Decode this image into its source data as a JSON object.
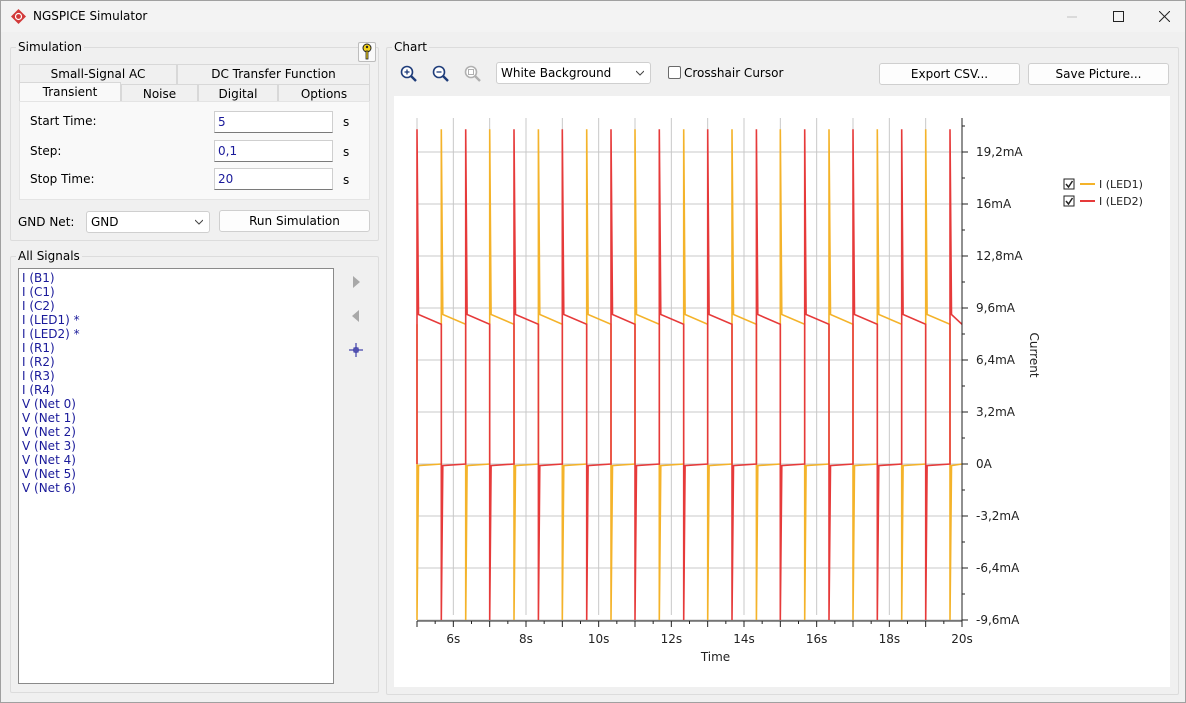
{
  "window": {
    "title": "NGSPICE Simulator"
  },
  "simulation": {
    "group_title": "Simulation",
    "tabs_row1": [
      "Small-Signal AC",
      "DC Transfer Function"
    ],
    "tabs_row2": [
      "Transient",
      "Noise",
      "Digital",
      "Options"
    ],
    "active_tab": "Transient",
    "fields": {
      "start_time": {
        "label": "Start Time:",
        "value": "5",
        "unit": "s"
      },
      "step": {
        "label": "Step:",
        "value": "0,1",
        "unit": "s"
      },
      "stop_time": {
        "label": "Stop Time:",
        "value": "20",
        "unit": "s"
      }
    },
    "gnd_label": "GND Net:",
    "gnd_value": "GND",
    "run_button": "Run Simulation"
  },
  "signals": {
    "group_title": "All Signals",
    "items": [
      "I (B1)",
      "I (C1)",
      "I (C2)",
      "I (LED1) *",
      "I (LED2) *",
      "I (R1)",
      "I (R2)",
      "I (R3)",
      "I (R4)",
      "V (Net 0)",
      "V (Net 1)",
      "V (Net 2)",
      "V (Net 3)",
      "V (Net 4)",
      "V (Net 5)",
      "V (Net 6)"
    ]
  },
  "chart_panel": {
    "group_title": "Chart",
    "background_select": "White Background",
    "crosshair_label": "Crosshair Cursor",
    "crosshair_checked": false,
    "export_button": "Export CSV...",
    "save_button": "Save Picture..."
  },
  "chart_data": {
    "type": "line",
    "xlabel": "Time",
    "ylabel": "Current",
    "x_ticks": [
      "6s",
      "8s",
      "10s",
      "12s",
      "14s",
      "16s",
      "18s",
      "20s"
    ],
    "x_tick_values": [
      6,
      8,
      10,
      12,
      14,
      16,
      18,
      20
    ],
    "y_ticks": [
      "19,2mA",
      "16mA",
      "12,8mA",
      "9,6mA",
      "6,4mA",
      "3,2mA",
      "0A",
      "-3,2mA",
      "-6,4mA",
      "-9,6mA"
    ],
    "y_tick_values": [
      19.2,
      16,
      12.8,
      9.6,
      6.4,
      3.2,
      0,
      -3.2,
      -6.4,
      -9.6
    ],
    "xlim": [
      5,
      20
    ],
    "ylim": [
      -9.6,
      21.5
    ],
    "grid": true,
    "legend_position": "top-right",
    "series": [
      {
        "name": "I (LED1)",
        "color": "#f4b32a",
        "checked": true,
        "high_level": 8.6,
        "low_level": 0,
        "spike_high": 20.6,
        "spike_low": -9.6,
        "rise_times": [
          5.67,
          7.0,
          8.34,
          9.67,
          11.0,
          12.34,
          13.67,
          15.0,
          16.34,
          17.67,
          19.0
        ],
        "fall_times": [
          5.0,
          6.34,
          7.67,
          9.0,
          10.34,
          11.67,
          13.0,
          14.34,
          15.67,
          17.0,
          18.34,
          19.67
        ]
      },
      {
        "name": "I (LED2)",
        "color": "#e63a3a",
        "checked": true,
        "high_level": 8.6,
        "low_level": 0,
        "spike_high": 20.6,
        "spike_low": -9.6,
        "rise_times": [
          5.0,
          6.34,
          7.67,
          9.0,
          10.34,
          11.67,
          13.0,
          14.34,
          15.67,
          17.0,
          18.34,
          19.67
        ],
        "fall_times": [
          5.67,
          7.0,
          8.34,
          9.67,
          11.0,
          12.34,
          13.67,
          15.0,
          16.34,
          17.67,
          19.0
        ]
      }
    ]
  }
}
